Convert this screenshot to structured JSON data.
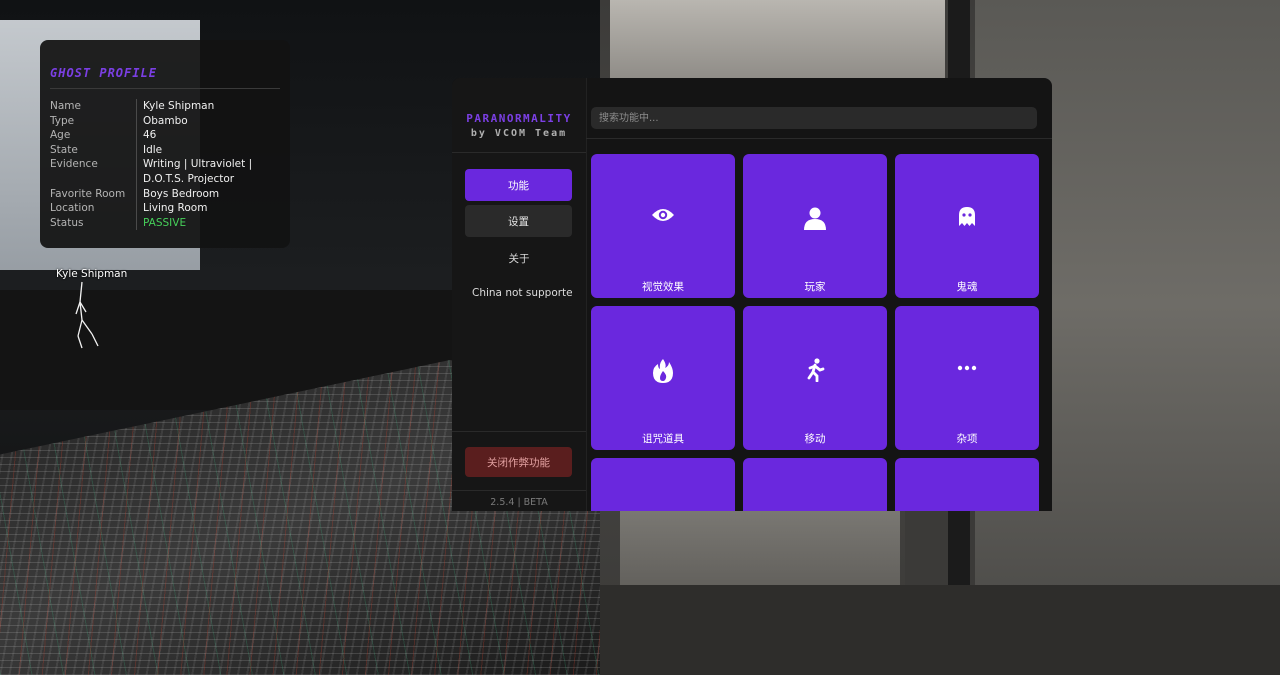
{
  "ghost_profile": {
    "title": "GHOST PROFILE",
    "rows": [
      {
        "key": "Name",
        "value": "Kyle Shipman"
      },
      {
        "key": "Type",
        "value": "Obambo"
      },
      {
        "key": "Age",
        "value": "46"
      },
      {
        "key": "State",
        "value": "Idle"
      },
      {
        "key": "Evidence",
        "value": "Writing | Ultraviolet | D.O.T.S. Projector"
      },
      {
        "key": "Favorite Room",
        "value": "Boys Bedroom"
      },
      {
        "key": "Location",
        "value": "Living Room"
      },
      {
        "key": "Status",
        "value": "PASSIVE"
      }
    ],
    "status_color": "#46d05a"
  },
  "ghost_figure": {
    "label": "Kyle Shipman"
  },
  "menu": {
    "brand_line1": "PARANORMALITY",
    "brand_line2": "by VCOM Team",
    "accent_color": "#6a28de",
    "nav": [
      {
        "label": "功能",
        "active": true
      },
      {
        "label": "设置",
        "active": false
      },
      {
        "label": "关于",
        "active": false
      },
      {
        "label": "China not supported",
        "active": false
      }
    ],
    "disable_button": "关闭作弊功能",
    "version": "2.5.4 | BETA",
    "search_placeholder": "搜索功能中...",
    "tiles": [
      {
        "label": "视觉效果",
        "icon": "eye-icon"
      },
      {
        "label": "玩家",
        "icon": "user-icon"
      },
      {
        "label": "鬼魂",
        "icon": "ghost-icon"
      },
      {
        "label": "诅咒道具",
        "icon": "fire-icon"
      },
      {
        "label": "移动",
        "icon": "running-icon"
      },
      {
        "label": "杂项",
        "icon": "ellipsis-icon"
      },
      {
        "label": "",
        "icon": ""
      },
      {
        "label": "",
        "icon": ""
      },
      {
        "label": "",
        "icon": ""
      }
    ]
  }
}
